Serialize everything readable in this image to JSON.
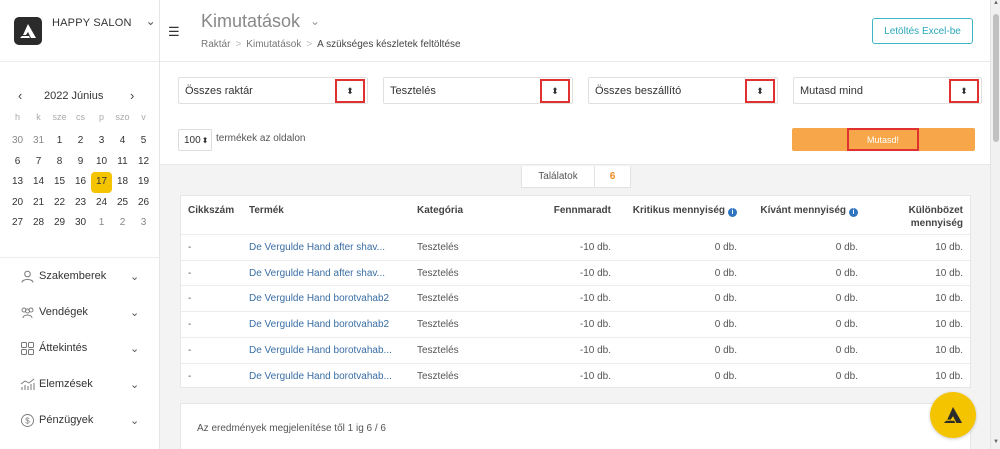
{
  "brand": {
    "name": "HAPPY SALON"
  },
  "calendar": {
    "title": "2022 Június",
    "weekdays": [
      "h",
      "k",
      "sze",
      "cs",
      "p",
      "szo",
      "v"
    ],
    "days": [
      {
        "d": "30",
        "muted": true
      },
      {
        "d": "31",
        "muted": true
      },
      {
        "d": "1"
      },
      {
        "d": "2"
      },
      {
        "d": "3"
      },
      {
        "d": "4"
      },
      {
        "d": "5"
      },
      {
        "d": "6"
      },
      {
        "d": "7"
      },
      {
        "d": "8"
      },
      {
        "d": "9"
      },
      {
        "d": "10"
      },
      {
        "d": "11"
      },
      {
        "d": "12"
      },
      {
        "d": "13"
      },
      {
        "d": "14"
      },
      {
        "d": "15"
      },
      {
        "d": "16"
      },
      {
        "d": "17",
        "today": true
      },
      {
        "d": "18"
      },
      {
        "d": "19"
      },
      {
        "d": "20"
      },
      {
        "d": "21"
      },
      {
        "d": "22"
      },
      {
        "d": "23"
      },
      {
        "d": "24"
      },
      {
        "d": "25"
      },
      {
        "d": "26"
      },
      {
        "d": "27"
      },
      {
        "d": "28"
      },
      {
        "d": "29"
      },
      {
        "d": "30"
      },
      {
        "d": "1",
        "muted": true
      },
      {
        "d": "2",
        "muted": true
      },
      {
        "d": "3",
        "muted": true
      }
    ],
    "today_color": "#f5c400"
  },
  "nav": {
    "items": [
      {
        "label": "Szakemberek",
        "icon": "user-icon"
      },
      {
        "label": "Vendégek",
        "icon": "users-icon"
      },
      {
        "label": "Áttekintés",
        "icon": "grid-icon"
      },
      {
        "label": "Elemzések",
        "icon": "chart-icon"
      },
      {
        "label": "Pénzügyek",
        "icon": "dollar-icon"
      }
    ]
  },
  "header": {
    "title": "Kimutatások",
    "breadcrumb": [
      "Raktár",
      "Kimutatások",
      "A szükséges készletek feltöltése"
    ],
    "excel_button": "Letöltés Excel-be"
  },
  "filters": {
    "warehouse": "Összes raktár",
    "category": "Tesztelés",
    "supplier": "Összes beszállító",
    "show_mode": "Mutasd mind",
    "per_page": "100",
    "per_page_label": "termékek az oldalon",
    "show_button": "Mutasd!"
  },
  "results": {
    "label": "Találatok",
    "count": "6"
  },
  "table": {
    "headers": {
      "sku": "Cikkszám",
      "product": "Termék",
      "category": "Kategória",
      "remaining": "Fennmaradt",
      "critical": "Kritikus mennyiség",
      "desired": "Kívánt mennyiség",
      "diff_line1": "Különbözet",
      "diff_line2": "mennyiség"
    },
    "rows": [
      {
        "sku": "-",
        "product": "De Vergulde Hand after shav...",
        "category": "Tesztelés",
        "remaining": "-10 db.",
        "critical": "0 db.",
        "desired": "0 db.",
        "diff": "10 db."
      },
      {
        "sku": "-",
        "product": "De Vergulde Hand after shav...",
        "category": "Tesztelés",
        "remaining": "-10 db.",
        "critical": "0 db.",
        "desired": "0 db.",
        "diff": "10 db."
      },
      {
        "sku": "-",
        "product": "De Vergulde Hand borotvahab2",
        "category": "Tesztelés",
        "remaining": "-10 db.",
        "critical": "0 db.",
        "desired": "0 db.",
        "diff": "10 db."
      },
      {
        "sku": "-",
        "product": "De Vergulde Hand borotvahab2",
        "category": "Tesztelés",
        "remaining": "-10 db.",
        "critical": "0 db.",
        "desired": "0 db.",
        "diff": "10 db."
      },
      {
        "sku": "-",
        "product": "De Vergulde Hand borotvahab...",
        "category": "Tesztelés",
        "remaining": "-10 db.",
        "critical": "0 db.",
        "desired": "0 db.",
        "diff": "10 db."
      },
      {
        "sku": "-",
        "product": "De Vergulde Hand borotvahab...",
        "category": "Tesztelés",
        "remaining": "-10 db.",
        "critical": "0 db.",
        "desired": "0 db.",
        "diff": "10 db."
      }
    ]
  },
  "footer": {
    "summary": "Az eredmények megjelenítése től 1 ig 6 / 6"
  },
  "colors": {
    "accent": "#f7a74a",
    "link": "#3a6ea5",
    "excel": "#2ba8b8",
    "highlight": "#e03131"
  }
}
